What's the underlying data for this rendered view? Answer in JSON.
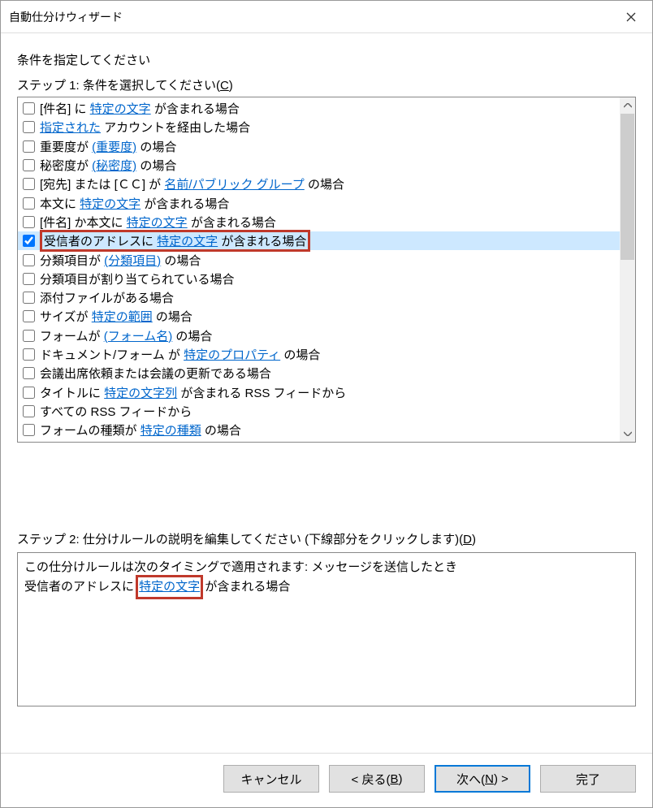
{
  "title": "自動仕分けウィザード",
  "heading": "条件を指定してください",
  "step1_prefix": "ステップ 1: 条件を選択してください(",
  "step1_key": "C",
  "step1_suffix": ")",
  "rows": [
    {
      "checked": false,
      "selected": false,
      "parts": [
        {
          "t": "[件名] に "
        },
        {
          "t": "特定の文字",
          "link": true
        },
        {
          "t": " が含まれる場合"
        }
      ]
    },
    {
      "checked": false,
      "selected": false,
      "parts": [
        {
          "t": "指定された",
          "link": true
        },
        {
          "t": " アカウントを経由した場合"
        }
      ]
    },
    {
      "checked": false,
      "selected": false,
      "parts": [
        {
          "t": "重要度が "
        },
        {
          "t": "(重要度)",
          "link": true
        },
        {
          "t": " の場合"
        }
      ]
    },
    {
      "checked": false,
      "selected": false,
      "parts": [
        {
          "t": "秘密度が "
        },
        {
          "t": "(秘密度)",
          "link": true
        },
        {
          "t": " の場合"
        }
      ]
    },
    {
      "checked": false,
      "selected": false,
      "parts": [
        {
          "t": "[宛先] または [ＣＣ] が "
        },
        {
          "t": "名前/パブリック グループ",
          "link": true
        },
        {
          "t": " の場合"
        }
      ]
    },
    {
      "checked": false,
      "selected": false,
      "parts": [
        {
          "t": "本文に "
        },
        {
          "t": "特定の文字",
          "link": true
        },
        {
          "t": " が含まれる場合"
        }
      ]
    },
    {
      "checked": false,
      "selected": false,
      "parts": [
        {
          "t": "[件名] か本文に "
        },
        {
          "t": "特定の文字",
          "link": true
        },
        {
          "t": " が含まれる場合"
        }
      ]
    },
    {
      "checked": true,
      "selected": true,
      "highlight": true,
      "parts": [
        {
          "t": "受信者のアドレスに "
        },
        {
          "t": "特定の文字",
          "link": true
        },
        {
          "t": " が含まれる場合"
        }
      ]
    },
    {
      "checked": false,
      "selected": false,
      "parts": [
        {
          "t": "分類項目が "
        },
        {
          "t": "(分類項目)",
          "link": true
        },
        {
          "t": " の場合"
        }
      ]
    },
    {
      "checked": false,
      "selected": false,
      "parts": [
        {
          "t": "分類項目が割り当てられている場合"
        }
      ]
    },
    {
      "checked": false,
      "selected": false,
      "parts": [
        {
          "t": "添付ファイルがある場合"
        }
      ]
    },
    {
      "checked": false,
      "selected": false,
      "parts": [
        {
          "t": "サイズが "
        },
        {
          "t": "特定の範囲",
          "link": true
        },
        {
          "t": " の場合"
        }
      ]
    },
    {
      "checked": false,
      "selected": false,
      "parts": [
        {
          "t": "フォームが "
        },
        {
          "t": "(フォーム名)",
          "link": true
        },
        {
          "t": " の場合"
        }
      ]
    },
    {
      "checked": false,
      "selected": false,
      "parts": [
        {
          "t": "ドキュメント/フォーム が "
        },
        {
          "t": "特定のプロパティ",
          "link": true
        },
        {
          "t": " の場合"
        }
      ]
    },
    {
      "checked": false,
      "selected": false,
      "parts": [
        {
          "t": "会議出席依頼または会議の更新である場合"
        }
      ]
    },
    {
      "checked": false,
      "selected": false,
      "parts": [
        {
          "t": "タイトルに "
        },
        {
          "t": "特定の文字列",
          "link": true
        },
        {
          "t": " が含まれる RSS フィードから"
        }
      ]
    },
    {
      "checked": false,
      "selected": false,
      "parts": [
        {
          "t": "すべての RSS フィードから"
        }
      ]
    },
    {
      "checked": false,
      "selected": false,
      "parts": [
        {
          "t": "フォームの種類が "
        },
        {
          "t": "特定の種類",
          "link": true
        },
        {
          "t": " の場合"
        }
      ]
    }
  ],
  "step2_prefix": "ステップ 2: 仕分けルールの説明を編集してください (下線部分をクリックします)(",
  "step2_key": "D",
  "step2_suffix": ")",
  "desc_line1": "この仕分けルールは次のタイミングで適用されます: メッセージを送信したとき",
  "desc_line2_pre": "受信者のアドレスに ",
  "desc_line2_link": "特定の文字",
  "desc_line2_post": " が含まれる場合",
  "buttons": {
    "cancel": "キャンセル",
    "back_pre": "< 戻る(",
    "back_key": "B",
    "back_post": ")",
    "next_pre": "次へ(",
    "next_key": "N",
    "next_post": ") >",
    "finish": "完了"
  }
}
